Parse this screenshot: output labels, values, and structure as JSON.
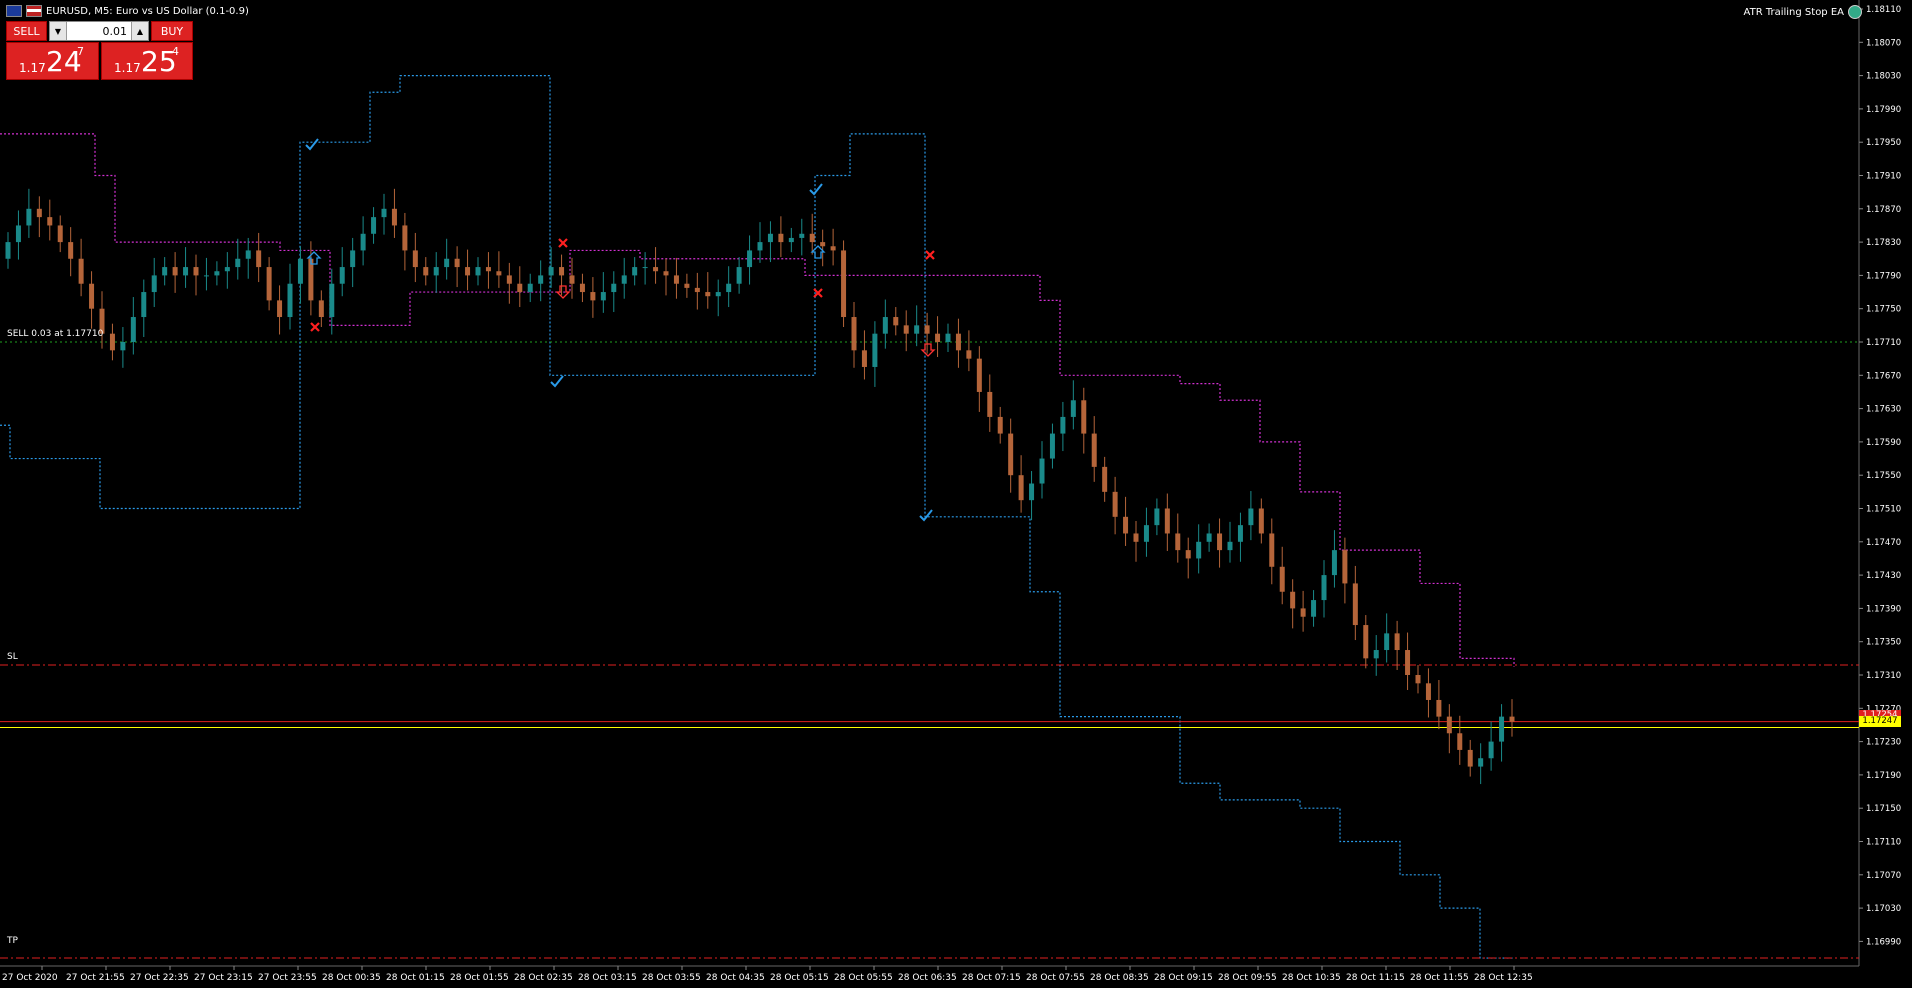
{
  "header": {
    "symbol_title": "EURUSD, M5:  Euro vs US Dollar (0.1-0.9)",
    "ea_name": "ATR Trailing Stop EA"
  },
  "trade_panel": {
    "sell_label": "SELL",
    "buy_label": "BUY",
    "lot_value": "0.01",
    "sell_price": {
      "small": "1.17",
      "big": "24",
      "sup": "7"
    },
    "buy_price": {
      "small": "1.17",
      "big": "25",
      "sup": "4"
    }
  },
  "chart_lines": {
    "position_label": "SELL 0.03 at 1.17710",
    "sl_label": "SL",
    "tp_label": "TP",
    "ask_price": "1.17254",
    "bid_price": "1.17247"
  },
  "price_axis": {
    "ticks": [
      "1.18110",
      "1.18070",
      "1.18030",
      "1.17990",
      "1.17950",
      "1.17910",
      "1.17870",
      "1.17830",
      "1.17790",
      "1.17750",
      "1.17710",
      "1.17670",
      "1.17630",
      "1.17590",
      "1.17550",
      "1.17510",
      "1.17470",
      "1.17430",
      "1.17390",
      "1.17350",
      "1.17310",
      "1.17270",
      "1.17230",
      "1.17190",
      "1.17150",
      "1.17110",
      "1.17070",
      "1.17030",
      "1.16990"
    ]
  },
  "time_axis": {
    "ticks": [
      "27 Oct 2020",
      "27 Oct 21:55",
      "27 Oct 22:35",
      "27 Oct 23:15",
      "27 Oct 23:55",
      "28 Oct 00:35",
      "28 Oct 01:15",
      "28 Oct 01:55",
      "28 Oct 02:35",
      "28 Oct 03:15",
      "28 Oct 03:55",
      "28 Oct 04:35",
      "28 Oct 05:15",
      "28 Oct 05:55",
      "28 Oct 06:35",
      "28 Oct 07:15",
      "28 Oct 07:55",
      "28 Oct 08:35",
      "28 Oct 09:15",
      "28 Oct 09:55",
      "28 Oct 10:35",
      "28 Oct 11:15",
      "28 Oct 11:55",
      "28 Oct 12:35"
    ]
  },
  "colors": {
    "background": "#000000",
    "bull_candle": "#1a8a8a",
    "bear_candle": "#b5653a",
    "upper_band": "#d030d0",
    "lower_band": "#2a9ae8",
    "position_line": "#20a020",
    "sl_tp_line": "#e02020",
    "bid_line": "#ffff00",
    "ask_line": "#e02020"
  },
  "chart_data": {
    "type": "candlestick",
    "symbol": "EURUSD",
    "timeframe": "M5",
    "ylim": [
      1.1697,
      1.18125
    ],
    "position_price": 1.1771,
    "sl_price": 1.17322,
    "tp_price": 1.1697,
    "ask": 1.17254,
    "bid": 1.17247,
    "closes": [
      1.1783,
      1.1785,
      1.1787,
      1.1786,
      1.1785,
      1.1783,
      1.1781,
      1.1778,
      1.1775,
      1.1772,
      1.177,
      1.1771,
      1.1774,
      1.1777,
      1.1779,
      1.178,
      1.1779,
      1.178,
      1.1779,
      1.1779,
      1.17795,
      1.178,
      1.1781,
      1.1782,
      1.178,
      1.1776,
      1.1774,
      1.1778,
      1.1781,
      1.1776,
      1.1774,
      1.1778,
      1.178,
      1.1782,
      1.1784,
      1.1786,
      1.1787,
      1.1785,
      1.1782,
      1.178,
      1.1779,
      1.178,
      1.1781,
      1.178,
      1.1779,
      1.178,
      1.17795,
      1.1779,
      1.1778,
      1.1777,
      1.1778,
      1.1779,
      1.178,
      1.1779,
      1.1778,
      1.1777,
      1.1776,
      1.1777,
      1.1778,
      1.1779,
      1.178,
      1.178,
      1.17795,
      1.1779,
      1.1778,
      1.17775,
      1.1777,
      1.17765,
      1.1777,
      1.1778,
      1.178,
      1.1782,
      1.1783,
      1.1784,
      1.1783,
      1.17835,
      1.1784,
      1.1783,
      1.17825,
      1.1782,
      1.1774,
      1.177,
      1.1768,
      1.1772,
      1.1774,
      1.1773,
      1.1772,
      1.1773,
      1.1772,
      1.1771,
      1.1772,
      1.177,
      1.1769,
      1.1765,
      1.1762,
      1.176,
      1.1755,
      1.1752,
      1.1754,
      1.1757,
      1.176,
      1.1762,
      1.1764,
      1.176,
      1.1756,
      1.1753,
      1.175,
      1.1748,
      1.1747,
      1.1749,
      1.1751,
      1.1748,
      1.1746,
      1.1745,
      1.1747,
      1.1748,
      1.1746,
      1.1747,
      1.1749,
      1.1751,
      1.1748,
      1.1744,
      1.1741,
      1.1739,
      1.1738,
      1.174,
      1.1743,
      1.1746,
      1.1742,
      1.1737,
      1.1733,
      1.1734,
      1.1736,
      1.1734,
      1.1731,
      1.173,
      1.1728,
      1.1726,
      1.1724,
      1.1722,
      1.172,
      1.1721,
      1.1723,
      1.1726,
      1.17254
    ]
  }
}
